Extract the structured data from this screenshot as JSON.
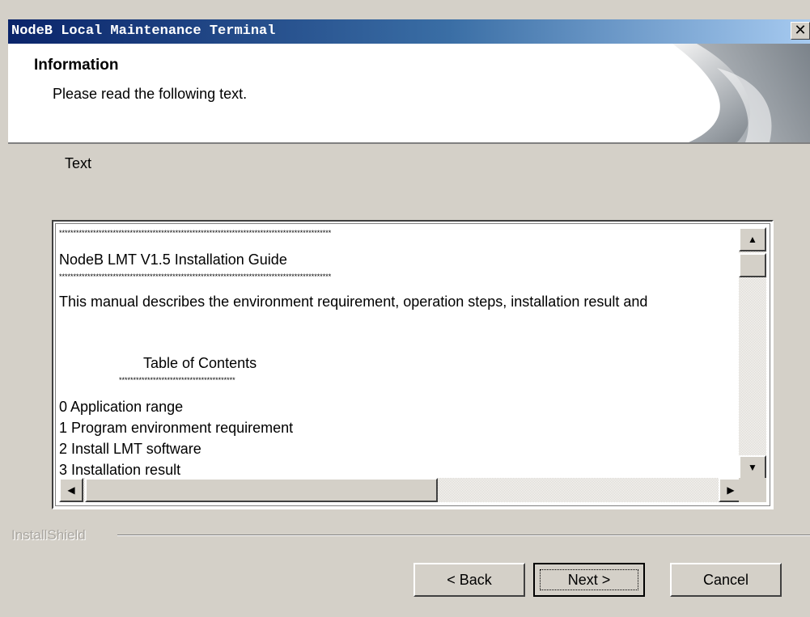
{
  "window": {
    "title": "NodeB Local Maintenance Terminal",
    "close_glyph": "✕"
  },
  "header": {
    "title": "Information",
    "subtitle": "Please read the following text."
  },
  "text_label": "Text",
  "document": {
    "lines": [
      {
        "text": "************************************************************************************************",
        "kind": "stars"
      },
      {
        "text": "NodeB LMT V1.5 Installation Guide",
        "kind": "text"
      },
      {
        "text": "************************************************************************************************",
        "kind": "stars"
      },
      {
        "text": "This manual describes the environment requirement, operation steps, installation result and",
        "kind": "text"
      },
      {
        "text": "Table of Contents",
        "kind": "text"
      },
      {
        "text": "*****************************************",
        "kind": "stars"
      },
      {
        "text": "0  Application range",
        "kind": "text"
      },
      {
        "text": "1  Program environment requirement",
        "kind": "text"
      },
      {
        "text": "2  Install LMT software",
        "kind": "text"
      },
      {
        "text": "3  Installation result",
        "kind": "text"
      }
    ]
  },
  "scrollbar": {
    "up_arrow": "▲",
    "down_arrow": "▼",
    "left_arrow": "◀",
    "right_arrow": "▶"
  },
  "footer": {
    "brand": "InstallShield"
  },
  "buttons": {
    "back": "< Back",
    "next": "Next >",
    "cancel": "Cancel"
  },
  "colors": {
    "dialog_bg": "#d4d0c8",
    "titlebar_start": "#0a246a",
    "titlebar_end": "#a6caf0"
  }
}
